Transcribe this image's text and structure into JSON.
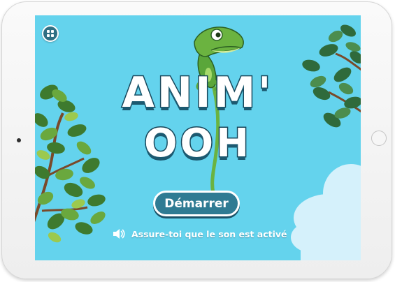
{
  "app": {
    "title_line_1": "ANIM'",
    "title_line_2": "OOH"
  },
  "buttons": {
    "start_label": "Démarrer",
    "menu_icon": "grid-menu-icon"
  },
  "notice": {
    "text": "Assure-toi que le son est activé",
    "icon": "speaker-icon"
  },
  "colors": {
    "sky": "#64d3ed",
    "button": "#2f7b93",
    "logo_outline": "#17465a"
  }
}
